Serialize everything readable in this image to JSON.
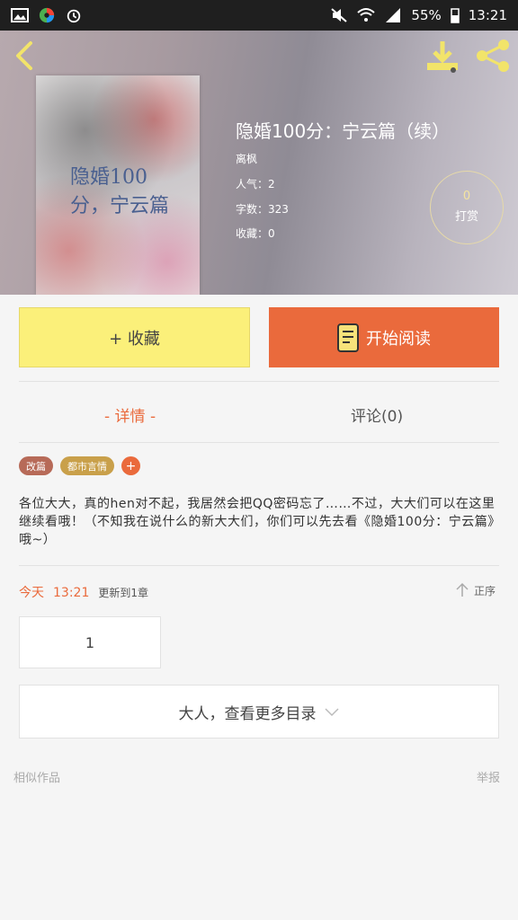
{
  "status_bar": {
    "battery": "55%",
    "time": "13:21"
  },
  "book": {
    "title": "隐婚100分：宁云篇（续）",
    "cover_text": "隐婚100分，宁云篇",
    "author": "离枫",
    "popularity": "人气：2",
    "word_count": "字数：323",
    "favorites": "收藏：0"
  },
  "tip": {
    "count": "0",
    "label": "打赏"
  },
  "actions": {
    "favorite_label": "+ 收藏",
    "read_label": "开始阅读"
  },
  "tabs": {
    "detail": "- 详情 -",
    "comment": "评论(0)"
  },
  "tags": [
    "改篇",
    "都市言情",
    "+"
  ],
  "description": "各位大大，真的hen对不起，我居然会把QQ密码忘了……不过，大大们可以在这里继续看哦！（不知我在说什么的新大大们，你们可以先去看《隐婚100分：宁云篇》哦~）",
  "update": {
    "day": "今天",
    "time": "13:21",
    "text": "更新到1章",
    "sort_label": "正序"
  },
  "chapters": [
    "1"
  ],
  "more_label": "大人，查看更多目录",
  "footer": {
    "similar": "相似作品",
    "report": "举报"
  },
  "colors": {
    "accent": "#ea6a3c",
    "favorite_bg": "#fbf07a"
  }
}
